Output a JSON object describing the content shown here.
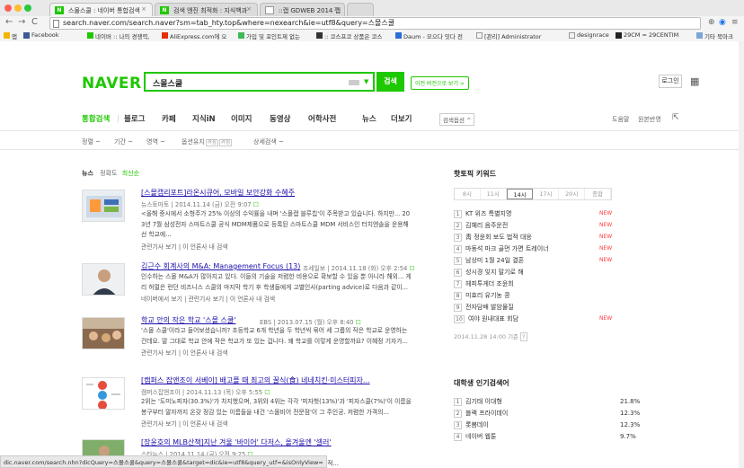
{
  "browser": {
    "tabs": [
      {
        "label": "스몰스쿨 : 네이버 통합검색"
      },
      {
        "label": "검색 엔진 최적화 : 지식백과"
      },
      {
        "label": "::캡 GDWEB 2014 캡"
      }
    ],
    "url": "search.naver.com/search.naver?sm=tab_hty.top&where=nexearch&ie=utf8&query=스몰스쿨",
    "bookmarks": [
      "앱",
      "Facebook",
      "네이버 :: 나의 경쟁력,",
      "AliExpress.com에 오",
      "가입 및 포인트제 없는",
      ":: 코스프코 상품은 코스",
      "Daum - 모으다 잇다 전",
      "[관리] Administrator",
      "designrace",
      "29CM = 29CENTIM",
      "기타 북마크"
    ],
    "nav_back": "←",
    "nav_fwd": "→",
    "nav_reload": "C"
  },
  "header": {
    "logo": "NAVER",
    "query": "스몰스쿨",
    "search_button": "검색",
    "old_version": "이전 버전으로 보기 >",
    "login": "로그인"
  },
  "gnb": {
    "items": [
      "통합검색",
      "블로그",
      "카페",
      "지식iN",
      "이미지",
      "동영상",
      "어학사전",
      "뉴스",
      "더보기"
    ],
    "search_option": "검색옵션 ^",
    "help": "도움말",
    "feedback": "원본반영"
  },
  "filters": {
    "items": [
      "정렬 ~",
      "기간 ~",
      "영역 ~",
      "옵션유지",
      "상세검색 ~"
    ],
    "option_on": "꺼짐",
    "option_off": "켜짐"
  },
  "news": {
    "title": "뉴스",
    "sort_accuracy": "정확도",
    "sort_latest": "최신순",
    "items": [
      {
        "title": "[스몰캡리포트]라온시큐어, 모바일 보안강화 수혜주",
        "source": "뉴스토마토 | 2014.11.14 (금) 오전 9:07",
        "desc1": "<올해 중시에서 소형주가 25% 이상의 수익률을 내며 '스몰캡 블루칩'이 주목받고 있습니다. 하지만... 201",
        "desc2": "3년 7월 삼성전자 스마트스쿨 공식 MDM제품으로 등록된 스마트스쿨 MDM 서비스인 터치엔솔을 운용해 잉",
        "desc3": "선 학교에...",
        "related": "관련기사 보기 | 이 언론사 내 검색"
      },
      {
        "title": "김근수 회계사의 M&A: Management Focus (13)",
        "source": "조세일보 | 2014.11.18 (화) 오후 2:54",
        "desc1": "인수하는 스몰 M&A가 많아지고 있다. 이들의 기술을 저렴한 비용으로 확보할 수 있을 뿐 아니라 해외... 게",
        "desc2": "리 허멀은 런던 비즈니스 스쿨의 마지막 학기 후 학생들에게 고별인사(parting advice)로 다음과 같이...",
        "desc3": "",
        "related": "네이버에서 보기 | 관련기사 보기 | 이 언론사 내 검색"
      },
      {
        "title": "학교 안의 작은 학교 '스몰 스쿨'",
        "source": "EBS | 2013.07.15 (월) 오후 8:40",
        "desc1": "'스몰 스쿨'이라고 들어보셨습니까? 초등학교 6개 학년을 두 학년씩 묶어 세 그룹의 작은 학교로 운영하는",
        "desc2": "건데요. 말 그대로 학교 안에 작은 학교가 또 있는 겁니다. 왜 학교를 이렇게 운영할까요? 이혜정 기자가...",
        "desc3": "",
        "related": "관련기사 보기 | 이 언론사 내 검색"
      },
      {
        "title": "[캠퍼스 잡앤조이 서베이] 배고플 때 최고의 꿀식(食) 네네치킨·미스터피자...",
        "source": "캠퍼스잡앤조이 | 2014.11.13 (목) 오후 5:55",
        "desc1": "2위는 '도미노피자(30.3%)'가 차지했으며, 3위와 4위는 각각 '피자헛(13%)'과 '피자스쿨(7%)'이 이름을...",
        "desc2": "봉구부터 말자까지 온갖 정감 있는 이름들을 내건 '스몰비어 전문점'이 그 주인공. 저렴한 가격의...",
        "desc3": "",
        "related": "관련기사 보기 | 이 언론사 내 검색"
      },
      {
        "title": "[장윤호의 MLB산책]지난 겨울 '바이어' 다저스, 올겨울엔 '셀러'",
        "source": "스타뉴스 | 2014.11.14 (금) 오전 9:25",
        "desc1": "이스와 달리 스몰마켓이라는 제한적인 재정적...",
        "desc2": "",
        "desc3": "",
        "related": ""
      }
    ]
  },
  "hot_topics": {
    "title": "핫토픽 키워드",
    "time_tabs": [
      "8시",
      "11시",
      "14시",
      "17시",
      "20시",
      "종합"
    ],
    "active_tab": "14시",
    "keywords": [
      {
        "rank": "1",
        "text": "KT 위즈 특별지명",
        "badge": "NEW"
      },
      {
        "rank": "2",
        "text": "김혜리 음주운전",
        "badge": "NEW"
      },
      {
        "rank": "3",
        "text": "靑 정윤회 보도 법적 대응",
        "badge": "NEW"
      },
      {
        "rank": "4",
        "text": "마동석 마크 골먼 가면 트레이너",
        "badge": "NEW"
      },
      {
        "rank": "5",
        "text": "남상미 1월 24일 결혼",
        "badge": "NEW"
      },
      {
        "rank": "6",
        "text": "성시경 잊지 말기로 해",
        "badge": ""
      },
      {
        "rank": "7",
        "text": "헤피투게더 조윤희",
        "badge": ""
      },
      {
        "rank": "8",
        "text": "미효리 유기농 콩",
        "badge": ""
      },
      {
        "rank": "9",
        "text": "전자담배 발암물질",
        "badge": ""
      },
      {
        "rank": "10",
        "text": "여야 원내대표 회담",
        "badge": "NEW"
      }
    ],
    "base_time": "2014.11.28 14:00 기준",
    "help": "?"
  },
  "college": {
    "title": "대학생 인기검색어",
    "keywords": [
      {
        "rank": "1",
        "text": "김기태 이대형",
        "pct": "21.8%"
      },
      {
        "rank": "2",
        "text": "블랙 프라이데이",
        "pct": "12.3%"
      },
      {
        "rank": "3",
        "text": "롯봄데이",
        "pct": "12.3%"
      },
      {
        "rank": "4",
        "text": "네이버 웹툰",
        "pct": "9.7%"
      }
    ]
  },
  "status_url": "dic.naver.com/search.nhn?dicQuery=스몰스쿨&query=스몰스쿨&target=dic&ie=utf8&query_utf=&isOnlyView=",
  "colors": {
    "brand": "#1ec800",
    "new_badge": "#ff3b3b",
    "link": "#1a0dab"
  }
}
